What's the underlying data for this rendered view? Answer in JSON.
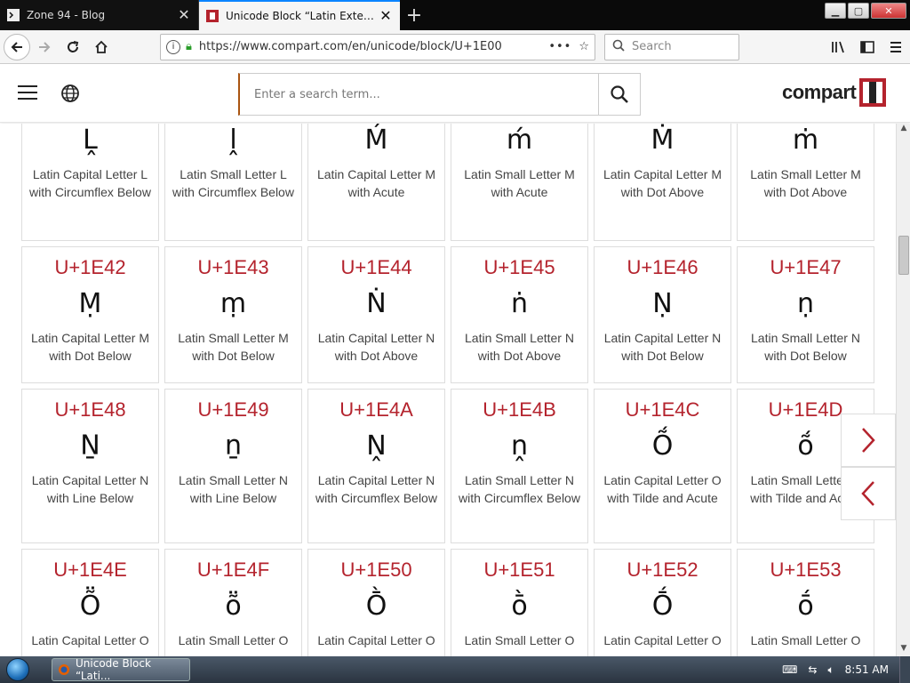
{
  "browser": {
    "tabs": [
      {
        "title": "Zone 94 - Blog",
        "active": false
      },
      {
        "title": "Unicode Block “Latin Extended Additional”",
        "active": true
      }
    ],
    "url": "https://www.compart.com/en/unicode/block/U+1E00",
    "search_placeholder": "Search"
  },
  "site": {
    "search_placeholder": "Enter a search term...",
    "logo_text": "compart",
    "brand_color": "#b4232d"
  },
  "cards": [
    {
      "code": "",
      "glyph": "Ḽ",
      "name": "Latin Capital Letter L with Circumflex Below"
    },
    {
      "code": "",
      "glyph": "ḽ",
      "name": "Latin Small Letter L with Circumflex Below"
    },
    {
      "code": "",
      "glyph": "Ḿ",
      "name": "Latin Capital Letter M with Acute"
    },
    {
      "code": "",
      "glyph": "ḿ",
      "name": "Latin Small Letter M with Acute"
    },
    {
      "code": "",
      "glyph": "Ṁ",
      "name": "Latin Capital Letter M with Dot Above"
    },
    {
      "code": "",
      "glyph": "ṁ",
      "name": "Latin Small Letter M with Dot Above"
    },
    {
      "code": "U+1E42",
      "glyph": "Ṃ",
      "name": "Latin Capital Letter M with Dot Below"
    },
    {
      "code": "U+1E43",
      "glyph": "ṃ",
      "name": "Latin Small Letter M with Dot Below"
    },
    {
      "code": "U+1E44",
      "glyph": "Ṅ",
      "name": "Latin Capital Letter N with Dot Above"
    },
    {
      "code": "U+1E45",
      "glyph": "ṅ",
      "name": "Latin Small Letter N with Dot Above"
    },
    {
      "code": "U+1E46",
      "glyph": "Ṇ",
      "name": "Latin Capital Letter N with Dot Below"
    },
    {
      "code": "U+1E47",
      "glyph": "ṇ",
      "name": "Latin Small Letter N with Dot Below"
    },
    {
      "code": "U+1E48",
      "glyph": "Ṉ",
      "name": "Latin Capital Letter N with Line Below"
    },
    {
      "code": "U+1E49",
      "glyph": "ṉ",
      "name": "Latin Small Letter N with Line Below"
    },
    {
      "code": "U+1E4A",
      "glyph": "Ṋ",
      "name": "Latin Capital Letter N with Circumflex Below"
    },
    {
      "code": "U+1E4B",
      "glyph": "ṋ",
      "name": "Latin Small Letter N with Circumflex Below"
    },
    {
      "code": "U+1E4C",
      "glyph": "Ṍ",
      "name": "Latin Capital Letter O with Tilde and Acute"
    },
    {
      "code": "U+1E4D",
      "glyph": "ṍ",
      "name": "Latin Small Letter O with Tilde and Acute"
    },
    {
      "code": "U+1E4E",
      "glyph": "Ṏ",
      "name": "Latin Capital Letter O"
    },
    {
      "code": "U+1E4F",
      "glyph": "ṏ",
      "name": "Latin Small Letter O"
    },
    {
      "code": "U+1E50",
      "glyph": "Ṑ",
      "name": "Latin Capital Letter O"
    },
    {
      "code": "U+1E51",
      "glyph": "ṑ",
      "name": "Latin Small Letter O"
    },
    {
      "code": "U+1E52",
      "glyph": "Ṓ",
      "name": "Latin Capital Letter O"
    },
    {
      "code": "U+1E53",
      "glyph": "ṓ",
      "name": "Latin Small Letter O"
    }
  ],
  "taskbar": {
    "items": [
      {
        "label": "Unicode Block “Lati..."
      }
    ],
    "clock": "8:51 AM"
  }
}
